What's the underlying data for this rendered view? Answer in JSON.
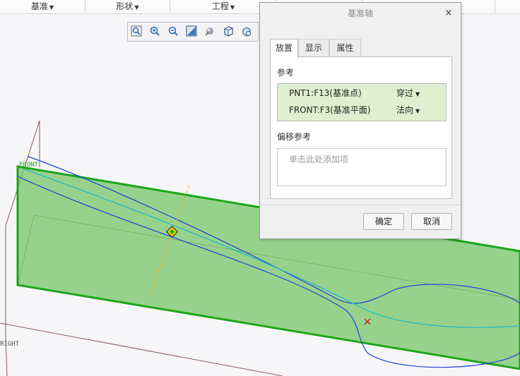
{
  "ribbon": {
    "groups": [
      {
        "label": "基准"
      },
      {
        "label": "形状"
      },
      {
        "label": "工程"
      }
    ]
  },
  "graphics": {
    "plane_labels": {
      "front": "FRONT",
      "right": "RIGHT"
    },
    "toolbar_icons": [
      "zoom-fit-icon",
      "zoom-in-icon",
      "zoom-out-icon",
      "repaint-icon",
      "spin-center-icon",
      "display-style-icon",
      "saved-orientation-icon"
    ]
  },
  "dialog": {
    "title": "基准轴",
    "close_glyph": "×",
    "tabs": [
      "放置",
      "显示",
      "属性"
    ],
    "active_tab": "放置",
    "references_label": "参考",
    "references": [
      {
        "name": "PNT1:F13(基准点)",
        "constraint": "穿过"
      },
      {
        "name": "FRONT:F3(基准平面)",
        "constraint": "法向"
      }
    ],
    "offset_label": "偏移参考",
    "offset_placeholder": "单击此处添加项",
    "ok_label": "确定",
    "cancel_label": "取消"
  },
  "colors": {
    "plane_fill": "#7cc86e",
    "plane_edge": "#1aa61a",
    "curve_blue": "#2040d8",
    "curve_cyan": "#20b8c8",
    "axis_orange": "#e8b020",
    "ref_highlight": "#def0cf"
  }
}
